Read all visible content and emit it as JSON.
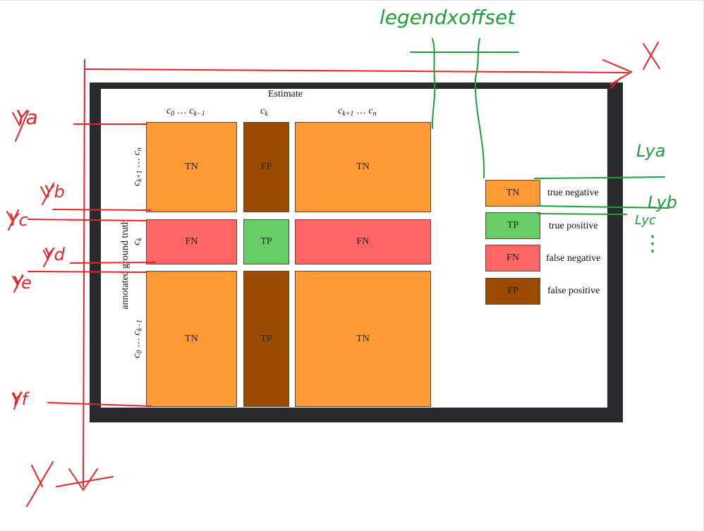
{
  "diagram": {
    "top_title": "Estimate",
    "side_title": "annotated ground truth",
    "column_headers": [
      {
        "a": "c",
        "a_sub": "0",
        "dots": " … ",
        "b": "c",
        "b_sub": "k−1"
      },
      {
        "a": "c",
        "a_sub": "k"
      },
      {
        "a": "c",
        "a_sub": "k+1",
        "dots": " … ",
        "b": "c",
        "b_sub": "n"
      }
    ],
    "row_headers": [
      {
        "a": "c",
        "a_sub": "k+1",
        "dots": " … ",
        "b": "c",
        "b_sub": "n"
      },
      {
        "a": "c",
        "a_sub": "k"
      },
      {
        "a": "c",
        "a_sub": "0",
        "dots": " … ",
        "b": "c",
        "b_sub": "k−1"
      }
    ],
    "cells": [
      [
        "TN",
        "FP",
        "TN"
      ],
      [
        "FN",
        "TP",
        "FN"
      ],
      [
        "TN",
        "TP",
        "TN"
      ]
    ],
    "legend": [
      {
        "code": "TN",
        "text": "true negative"
      },
      {
        "code": "TP",
        "text": "true positive"
      },
      {
        "code": "FN",
        "text": "false negative"
      },
      {
        "code": "FP",
        "text": "false positive"
      }
    ],
    "colors": {
      "TN": "#ff9a35",
      "FP": "#9a4b00",
      "FN": "#ff6565",
      "TP": "#66cc66",
      "frame": "#2a2a2e",
      "annotation_red": "#e8232a",
      "annotation_green": "#1f9e3a"
    }
  },
  "annotations": {
    "axis_x": "X",
    "axis_y": "Y",
    "ya": "Ya",
    "yb": "Yb",
    "yc": "Yc",
    "yd": "Yd",
    "ye": "Ye",
    "yf": "Yf",
    "legend_x_offset": "legendxoffset",
    "lya": "Lya",
    "lyb": "Lyb",
    "lyc": "Lyc",
    "dots": "⋮"
  }
}
